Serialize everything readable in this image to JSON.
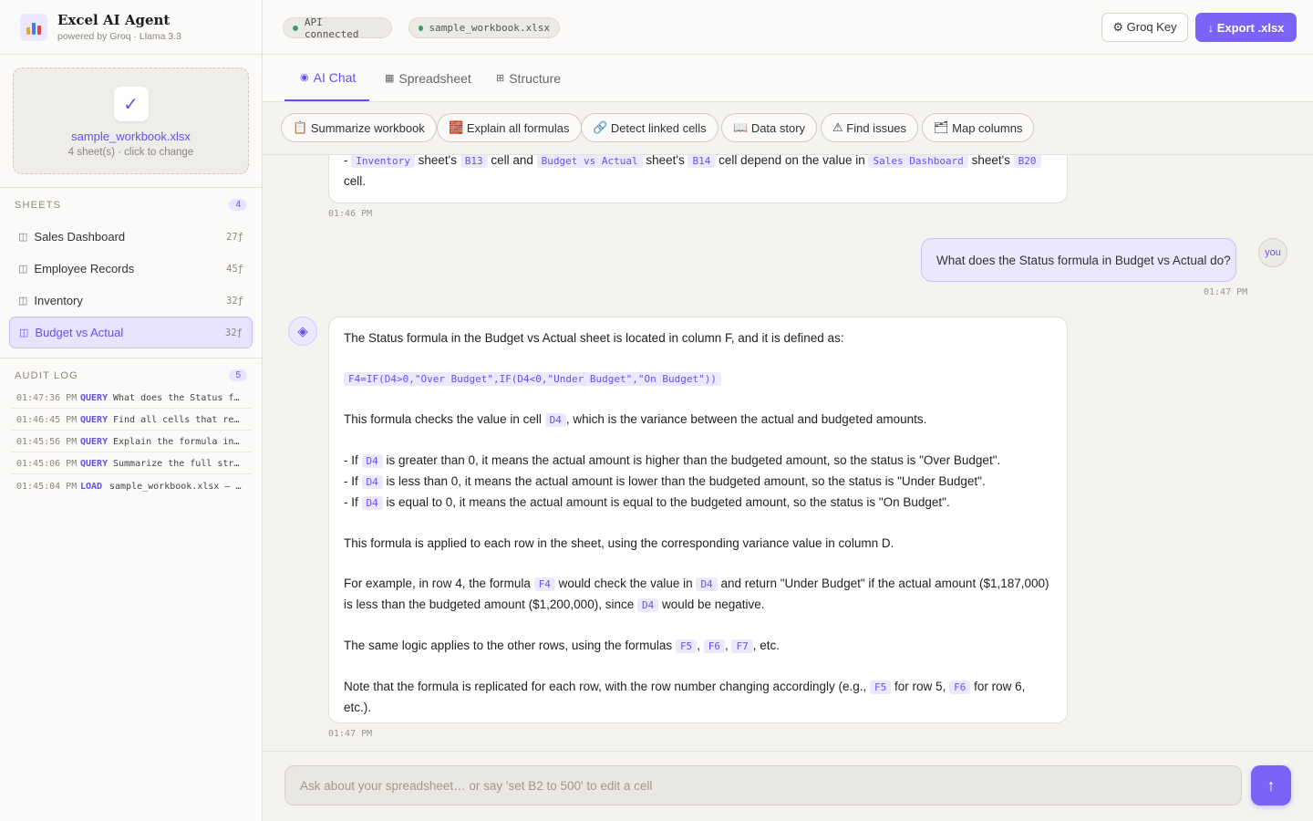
{
  "brand": {
    "title": "Excel AI Agent",
    "subtitle": "powered by Groq · Llama 3.3",
    "icon": "bar-chart-icon"
  },
  "upload": {
    "filename": "sample_workbook.xlsx",
    "note": "4 sheet(s) · click to change",
    "icon": "check-icon"
  },
  "sheets": {
    "title": "SHEETS",
    "count": "4",
    "items": [
      {
        "label": "Sales Dashboard",
        "count": "27ƒ"
      },
      {
        "label": "Employee Records",
        "count": "45ƒ"
      },
      {
        "label": "Inventory",
        "count": "32ƒ"
      },
      {
        "label": "Budget vs Actual",
        "count": "32ƒ"
      }
    ],
    "active_index": 3
  },
  "audit": {
    "title": "AUDIT LOG",
    "count": "5",
    "entries": [
      {
        "time": "01:47:36 PM",
        "type": "QUERY",
        "msg": "What does the Status f…"
      },
      {
        "time": "01:46:45 PM",
        "type": "QUERY",
        "msg": "Find all cells that re…"
      },
      {
        "time": "01:45:56 PM",
        "type": "QUERY",
        "msg": "Explain the formula in…"
      },
      {
        "time": "01:45:06 PM",
        "type": "QUERY",
        "msg": "Summarize the full str…"
      },
      {
        "time": "01:45:04 PM",
        "type": "LOAD",
        "msg": "sample_workbook.xlsx — …"
      }
    ]
  },
  "topbar": {
    "status": "API connected",
    "file": "sample_workbook.xlsx",
    "groq_key": "⚙ Groq Key",
    "export": "↓ Export .xlsx"
  },
  "tabs": [
    {
      "label": "AI Chat",
      "icon": "◉"
    },
    {
      "label": "Spreadsheet",
      "icon": "▦"
    },
    {
      "label": "Structure",
      "icon": "⊞"
    }
  ],
  "actions": [
    {
      "label": "Summarize workbook",
      "icon": "📋"
    },
    {
      "label": "Explain all formulas",
      "icon": "🧱"
    },
    {
      "label": "Detect linked cells",
      "icon": "🔗"
    },
    {
      "label": "Data story",
      "icon": "📖"
    },
    {
      "label": "Find issues",
      "icon": "⚠"
    },
    {
      "label": "Map columns",
      "icon": "🗂"
    }
  ],
  "chat": {
    "prev": {
      "t1": "- ",
      "c1": "Inventory",
      "t2": " sheet's ",
      "c2": "B13",
      "t3": " cell and ",
      "c3": "Budget vs Actual",
      "t4": " sheet's ",
      "c4": "B14",
      "t5": " cell depend on the value in ",
      "c5": "Sales Dashboard",
      "t6": " sheet's ",
      "c6": "B20",
      "line2": "cell.",
      "time": "01:46 PM"
    },
    "user": {
      "text": "What does the Status formula in Budget vs Actual do?",
      "avatar": "you",
      "time": "01:47 PM"
    },
    "reply": {
      "avatar_icon": "◈",
      "p1": "The Status formula in the Budget vs Actual sheet is located in column F, and it is defined as:",
      "formula": "F4=IF(D4>0,\"Over Budget\",IF(D4<0,\"Under Budget\",\"On Budget\"))",
      "p2a": "This formula checks the value in cell ",
      "p2c": "D4",
      "p2b": ", which is the variance between the actual and budgeted amounts.",
      "b1a": "- If ",
      "b1c": "D4",
      "b1b": " is greater than 0, it means the actual amount is higher than the budgeted amount, so the status is \"Over Budget\".",
      "b2a": "- If ",
      "b2c": "D4",
      "b2b": " is less than 0, it means the actual amount is lower than the budgeted amount, so the status is \"Under Budget\".",
      "b3a": "- If ",
      "b3c": "D4",
      "b3b": " is equal to 0, it means the actual amount is equal to the budgeted amount, so the status is \"On Budget\".",
      "p3": "This formula is applied to each row in the sheet, using the corresponding variance value in column D.",
      "p4a": "For example, in row 4, the formula ",
      "p4c1": "F4",
      "p4b": " would check the value in ",
      "p4c2": "D4",
      "p4d": " and return \"Under Budget\" if the actual amount ($1,187,000)",
      "p4e": "is less than the budgeted amount ($1,200,000), since ",
      "p4c3": "D4",
      "p4f": " would be negative.",
      "p5a": "The same logic applies to the other rows, using the formulas ",
      "p5c1": "F5",
      "p5s1": ", ",
      "p5c2": "F6",
      "p5s2": ", ",
      "p5c3": "F7",
      "p5b": ", etc.",
      "p6a": "Note that the formula is replicated for each row, with the row number changing accordingly (e.g., ",
      "p6c1": "F5",
      "p6b": " for row 5, ",
      "p6c2": "F6",
      "p6c": " for row 6,",
      "p6d": "etc.).",
      "time": "01:47 PM"
    }
  },
  "composer": {
    "placeholder": "Ask about your spreadsheet… or say 'set B2 to 500' to edit a cell",
    "send_icon": "↑"
  },
  "colors": {
    "accent": "#7c62f7",
    "accent_text": "#6a4ef5",
    "status_green": "#3d9a6e"
  }
}
